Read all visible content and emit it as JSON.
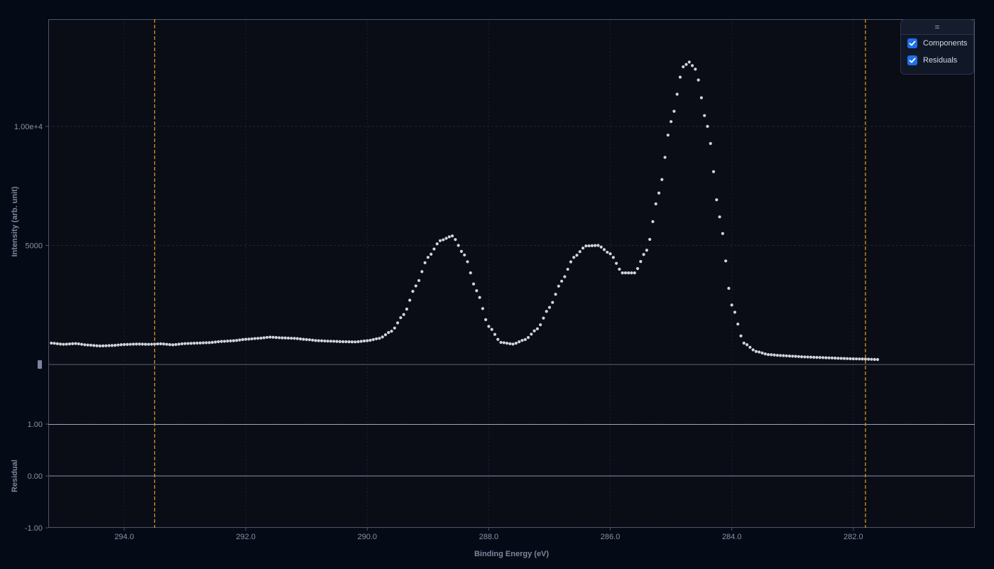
{
  "legend": {
    "handle_glyph": "=",
    "items": [
      {
        "label": "Components",
        "checked": true
      },
      {
        "label": "Residuals",
        "checked": true
      }
    ]
  },
  "colors": {
    "background": "#050a17",
    "plot_background": "#0a0d16",
    "points": "#cfd3dc",
    "range_markers": "#e6a01c",
    "checkbox": "#1e6ee8"
  },
  "chart_data": [
    {
      "type": "scatter",
      "title": "",
      "xlabel": "Binding Energy (eV)",
      "ylabel": "Intensity (arb. unit)",
      "x_reversed": true,
      "xlim": [
        295.25,
        280.0
      ],
      "ylim": [
        -2500,
        14500
      ],
      "x_ticks": [
        294,
        292,
        290,
        288,
        286,
        284,
        282
      ],
      "x_tick_labels": [
        "294.0",
        "292.0",
        "290.0",
        "288.0",
        "286.0",
        "284.0",
        "282.0"
      ],
      "y_ticks": [
        5000,
        10000
      ],
      "y_tick_labels": [
        "5000",
        "1.00e+4"
      ],
      "zero_line": 0,
      "grid": true,
      "range_markers_x": [
        293.5,
        281.8
      ],
      "series": [
        {
          "x": [
            295.2,
            295.0,
            294.8,
            294.6,
            294.4,
            294.2,
            294.0,
            293.8,
            293.6,
            293.4,
            293.2,
            293.0,
            292.8,
            292.6,
            292.4,
            292.2,
            292.0,
            291.8,
            291.6,
            291.4,
            291.2,
            291.0,
            290.8,
            290.6,
            290.4,
            290.2,
            290.0,
            289.8,
            289.6,
            289.4,
            289.2,
            289.0,
            288.8,
            288.6,
            288.4,
            288.2,
            288.0,
            287.8,
            287.6,
            287.4,
            287.2,
            287.0,
            286.8,
            286.6,
            286.4,
            286.2,
            286.0,
            285.8,
            285.6,
            285.4,
            285.2,
            285.0,
            284.8,
            284.7,
            284.6,
            284.4,
            284.2,
            284.0,
            283.8,
            283.6,
            283.4,
            283.2,
            283.0,
            282.8,
            282.6,
            282.4,
            282.2,
            282.0,
            281.8,
            281.6
          ],
          "y": [
            900,
            850,
            880,
            820,
            780,
            800,
            840,
            860,
            850,
            870,
            830,
            880,
            900,
            920,
            970,
            1000,
            1060,
            1100,
            1150,
            1120,
            1100,
            1050,
            1000,
            980,
            960,
            950,
            1000,
            1100,
            1400,
            2100,
            3300,
            4500,
            5200,
            5400,
            4600,
            3100,
            1600,
            930,
            860,
            1050,
            1500,
            2400,
            3500,
            4500,
            4980,
            5000,
            4650,
            3850,
            3850,
            4800,
            7200,
            10200,
            12500,
            12700,
            12400,
            10000,
            6200,
            2500,
            900,
            550,
            420,
            380,
            350,
            320,
            300,
            280,
            260,
            240,
            230,
            210
          ]
        }
      ]
    },
    {
      "type": "line",
      "title": "",
      "xlabel": "Binding Energy (eV)",
      "ylabel": "Residual",
      "x_reversed": true,
      "xlim": [
        295.25,
        280.0
      ],
      "ylim": [
        -1.0,
        1.0
      ],
      "y_ticks": [
        -1.0,
        0.0,
        1.0
      ],
      "y_tick_labels": [
        "-1.00",
        "0.00",
        "1.00"
      ],
      "zero_line": 0,
      "grid": true,
      "series": []
    }
  ]
}
